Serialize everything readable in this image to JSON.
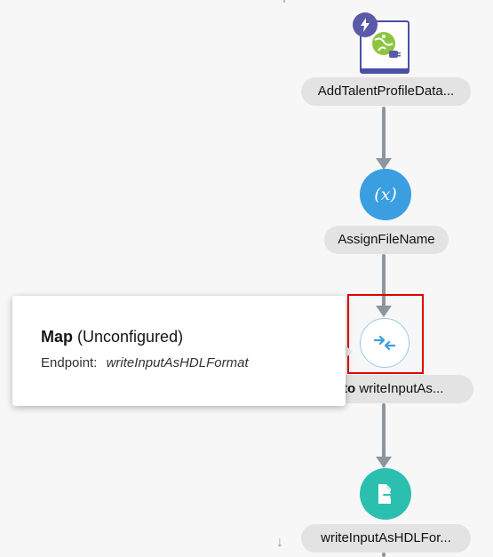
{
  "canvas": {
    "scroll_down_glyph": "↓"
  },
  "nodes": {
    "trigger": {
      "label": "AddTalentProfileData...",
      "icon": "rest-adapter-icon",
      "badge_icon": "bolt-icon"
    },
    "assign": {
      "label": "AssignFileName",
      "icon_text": "(x)",
      "color": "#3a9ee0"
    },
    "map": {
      "label_prefix": "to",
      "label": "writeInputAs...",
      "icon": "map-arrows-icon",
      "border_color": "#9cc8e6"
    },
    "write": {
      "label": "writeInputAsHDLFor...",
      "icon": "file-export-icon",
      "color": "#2bbfb0"
    }
  },
  "tooltip": {
    "title_bold": "Map",
    "title_rest": "(Unconfigured)",
    "endpoint_label": "Endpoint:",
    "endpoint_value": "writeInputAsHDLFormat"
  },
  "colors": {
    "connector": "#8d959e",
    "selection": "#e00000",
    "trigger_accent": "#4b4fa6"
  }
}
